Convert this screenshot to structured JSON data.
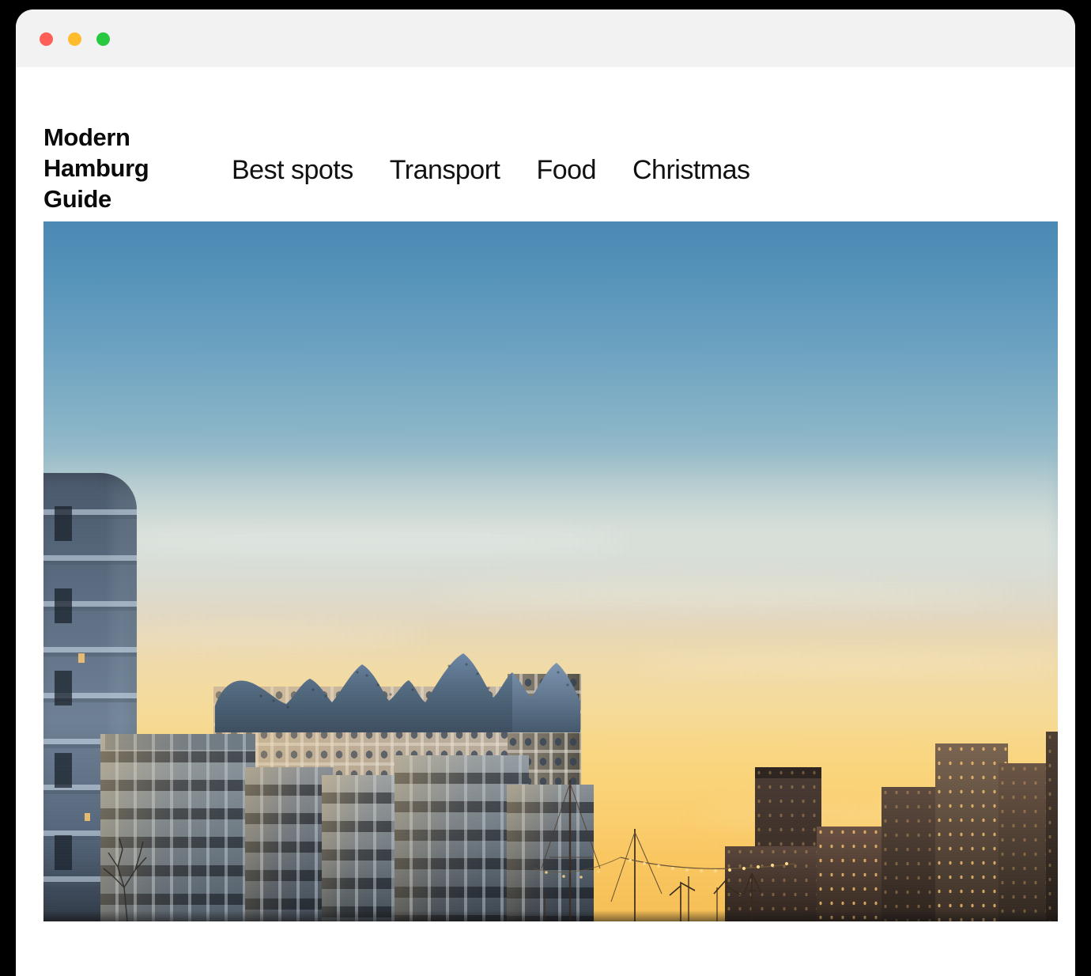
{
  "window": {
    "controls": [
      {
        "name": "close",
        "color": "#ff5f57"
      },
      {
        "name": "minimize",
        "color": "#ffbd2e"
      },
      {
        "name": "maximize",
        "color": "#28c840"
      }
    ]
  },
  "header": {
    "brand": {
      "lines": [
        "Modern",
        "Hamburg",
        "Guide"
      ],
      "full_text": "Modern Hamburg Guide"
    },
    "nav": [
      {
        "label": "Best spots"
      },
      {
        "label": "Transport"
      },
      {
        "label": "Food"
      },
      {
        "label": "Christmas"
      }
    ]
  },
  "hero": {
    "alt": "Elbphilharmonie concert hall and HafenCity waterfront in Hamburg at sunset",
    "subjects": [
      "Elbphilharmonie",
      "HafenCity apartment blocks",
      "curved glass residential tower",
      "sailboat masts and rigging",
      "harbour cranes",
      "string of festival lights"
    ],
    "colors": {
      "sky_top": "#4a89b4",
      "sky_mid": "#ccd8da",
      "sky_warm": "#f0dfba",
      "sky_horizon": "#fbcd6e",
      "building_glass": "#4b627f",
      "building_stone": "#b2a695",
      "silhouette_dark": "#2a211c"
    }
  },
  "theme": {
    "background": "#ffffff",
    "titlebar": "#f2f2f2",
    "text": "#111111"
  }
}
